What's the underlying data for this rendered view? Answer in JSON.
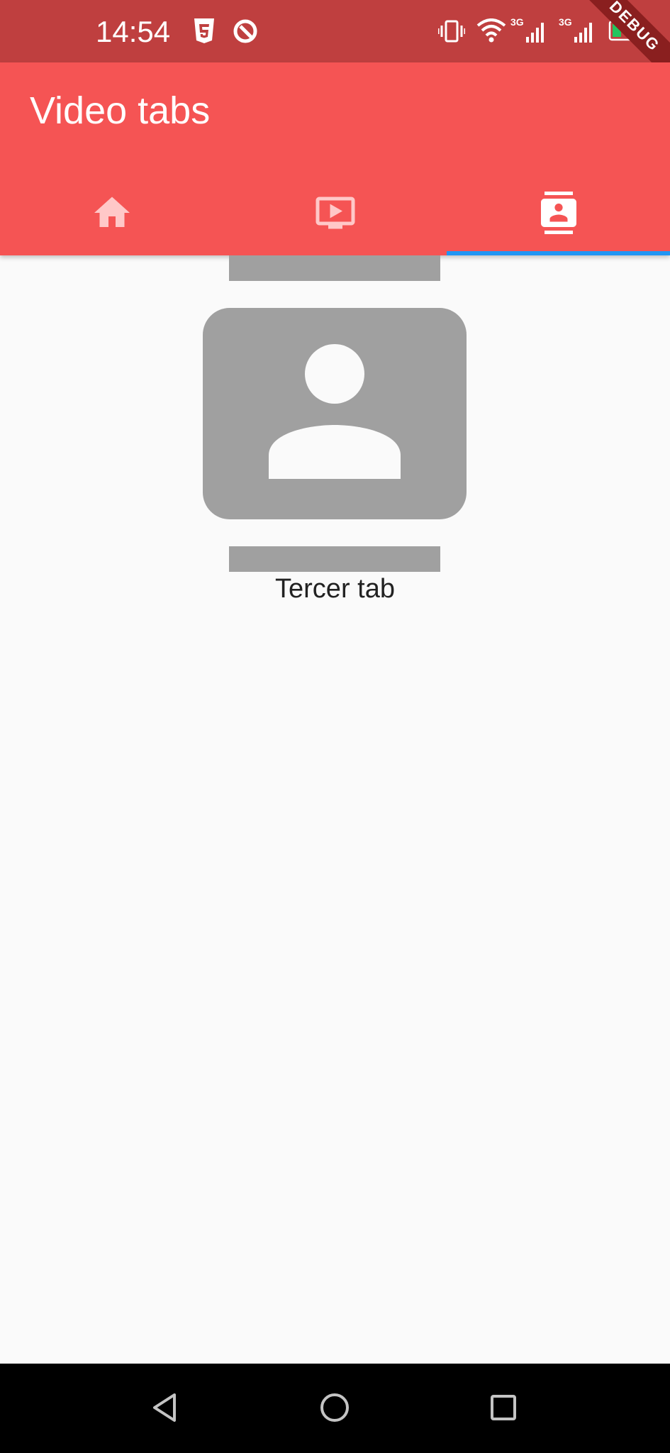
{
  "status_bar": {
    "time": "14:54",
    "battery": "26",
    "network_1": "3G",
    "network_2": "3G",
    "debug_banner": "DEBUG",
    "icons": [
      "html5-icon",
      "q-icon",
      "vibrate-icon",
      "wifi-icon",
      "signal-icon",
      "signal-icon",
      "battery-icon"
    ]
  },
  "app_bar": {
    "title": "Video tabs",
    "background_color": "#f55454",
    "indicator_color": "#2196f3"
  },
  "tabs": [
    {
      "icon": "home-icon",
      "selected": false
    },
    {
      "icon": "tv-play-icon",
      "selected": false
    },
    {
      "icon": "contact-card-icon",
      "selected": true
    }
  ],
  "content": {
    "icon": "contact-card-icon",
    "label": "Tercer tab"
  },
  "nav_bar": {
    "buttons": [
      "back-icon",
      "home-circle-icon",
      "recents-icon"
    ]
  }
}
